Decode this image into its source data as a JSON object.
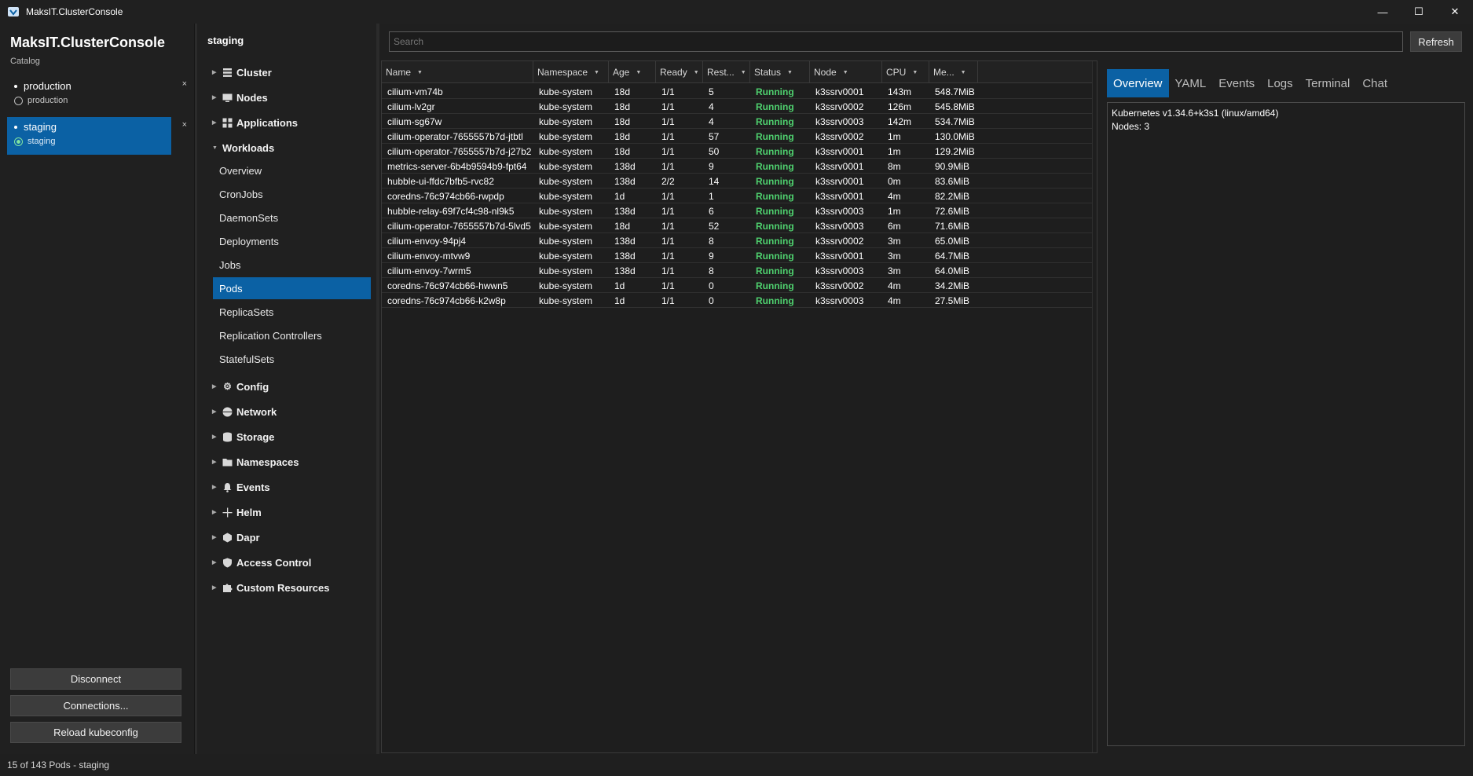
{
  "window": {
    "title": "MaksIT.ClusterConsole",
    "minimize": "—",
    "maximize": "☐",
    "close": "✕"
  },
  "sidebar": {
    "brand": "MaksIT.ClusterConsole",
    "catalog_label": "Catalog",
    "contexts": [
      {
        "name": "production",
        "cluster": "production",
        "active": false,
        "close": "×"
      },
      {
        "name": "staging",
        "cluster": "staging",
        "active": true,
        "close": "×"
      }
    ],
    "buttons": {
      "disconnect": "Disconnect",
      "connections": "Connections...",
      "reload": "Reload kubeconfig"
    }
  },
  "nav": {
    "title": "staging",
    "groups": [
      {
        "label": "Cluster",
        "icon": "list-icon"
      },
      {
        "label": "Nodes",
        "icon": "monitor-icon"
      },
      {
        "label": "Applications",
        "icon": "grid-icon"
      },
      {
        "label": "Workloads",
        "icon": "none"
      }
    ],
    "workload_items": [
      "Overview",
      "CronJobs",
      "DaemonSets",
      "Deployments",
      "Jobs",
      "Pods",
      "ReplicaSets",
      "Replication Controllers",
      "StatefulSets"
    ],
    "selected_item": "Pods",
    "lower_groups": [
      {
        "label": "Config",
        "icon": "gear-icon"
      },
      {
        "label": "Network",
        "icon": "globe-icon"
      },
      {
        "label": "Storage",
        "icon": "database-icon"
      },
      {
        "label": "Namespaces",
        "icon": "folder-icon"
      },
      {
        "label": "Events",
        "icon": "bell-icon"
      },
      {
        "label": "Helm",
        "icon": "plus-icon"
      },
      {
        "label": "Dapr",
        "icon": "hexagon-icon"
      },
      {
        "label": "Access Control",
        "icon": "shield-icon"
      },
      {
        "label": "Custom Resources",
        "icon": "puzzle-icon"
      }
    ]
  },
  "search": {
    "placeholder": "Search",
    "refresh_label": "Refresh"
  },
  "table": {
    "columns": [
      "Name",
      "Namespace",
      "Age",
      "Ready",
      "Rest...",
      "Status",
      "Node",
      "CPU",
      "Me..."
    ],
    "rows": [
      [
        "cilium-vm74b",
        "kube-system",
        "18d",
        "1/1",
        "5",
        "Running",
        "k3ssrv0001",
        "143m",
        "548.7MiB"
      ],
      [
        "cilium-lv2gr",
        "kube-system",
        "18d",
        "1/1",
        "4",
        "Running",
        "k3ssrv0002",
        "126m",
        "545.8MiB"
      ],
      [
        "cilium-sg67w",
        "kube-system",
        "18d",
        "1/1",
        "4",
        "Running",
        "k3ssrv0003",
        "142m",
        "534.7MiB"
      ],
      [
        "cilium-operator-7655557b7d-jtbtl",
        "kube-system",
        "18d",
        "1/1",
        "57",
        "Running",
        "k3ssrv0002",
        "1m",
        "130.0MiB"
      ],
      [
        "cilium-operator-7655557b7d-j27b2",
        "kube-system",
        "18d",
        "1/1",
        "50",
        "Running",
        "k3ssrv0001",
        "1m",
        "129.2MiB"
      ],
      [
        "metrics-server-6b4b9594b9-fpt64",
        "kube-system",
        "138d",
        "1/1",
        "9",
        "Running",
        "k3ssrv0001",
        "8m",
        "90.9MiB"
      ],
      [
        "hubble-ui-ffdc7bfb5-rvc82",
        "kube-system",
        "138d",
        "2/2",
        "14",
        "Running",
        "k3ssrv0001",
        "0m",
        "83.6MiB"
      ],
      [
        "coredns-76c974cb66-rwpdp",
        "kube-system",
        "1d",
        "1/1",
        "1",
        "Running",
        "k3ssrv0001",
        "4m",
        "82.2MiB"
      ],
      [
        "hubble-relay-69f7cf4c98-nl9k5",
        "kube-system",
        "138d",
        "1/1",
        "6",
        "Running",
        "k3ssrv0003",
        "1m",
        "72.6MiB"
      ],
      [
        "cilium-operator-7655557b7d-5lvd5",
        "kube-system",
        "18d",
        "1/1",
        "52",
        "Running",
        "k3ssrv0003",
        "6m",
        "71.6MiB"
      ],
      [
        "cilium-envoy-94pj4",
        "kube-system",
        "138d",
        "1/1",
        "8",
        "Running",
        "k3ssrv0002",
        "3m",
        "65.0MiB"
      ],
      [
        "cilium-envoy-mtvw9",
        "kube-system",
        "138d",
        "1/1",
        "9",
        "Running",
        "k3ssrv0001",
        "3m",
        "64.7MiB"
      ],
      [
        "cilium-envoy-7wrm5",
        "kube-system",
        "138d",
        "1/1",
        "8",
        "Running",
        "k3ssrv0003",
        "3m",
        "64.0MiB"
      ],
      [
        "coredns-76c974cb66-hwwn5",
        "kube-system",
        "1d",
        "1/1",
        "0",
        "Running",
        "k3ssrv0002",
        "4m",
        "34.2MiB"
      ],
      [
        "coredns-76c974cb66-k2w8p",
        "kube-system",
        "1d",
        "1/1",
        "0",
        "Running",
        "k3ssrv0003",
        "4m",
        "27.5MiB"
      ]
    ]
  },
  "detail": {
    "tabs": [
      "Overview",
      "YAML",
      "Events",
      "Logs",
      "Terminal",
      "Chat"
    ],
    "active_tab": "Overview",
    "lines": [
      "Kubernetes v1.34.6+k3s1 (linux/amd64)",
      "Nodes: 3"
    ]
  },
  "statusbar": {
    "text": "15 of 143 Pods - staging"
  },
  "colors": {
    "accent": "#0b61a4",
    "running": "#4fd16f",
    "background": "#1f1f1f"
  }
}
